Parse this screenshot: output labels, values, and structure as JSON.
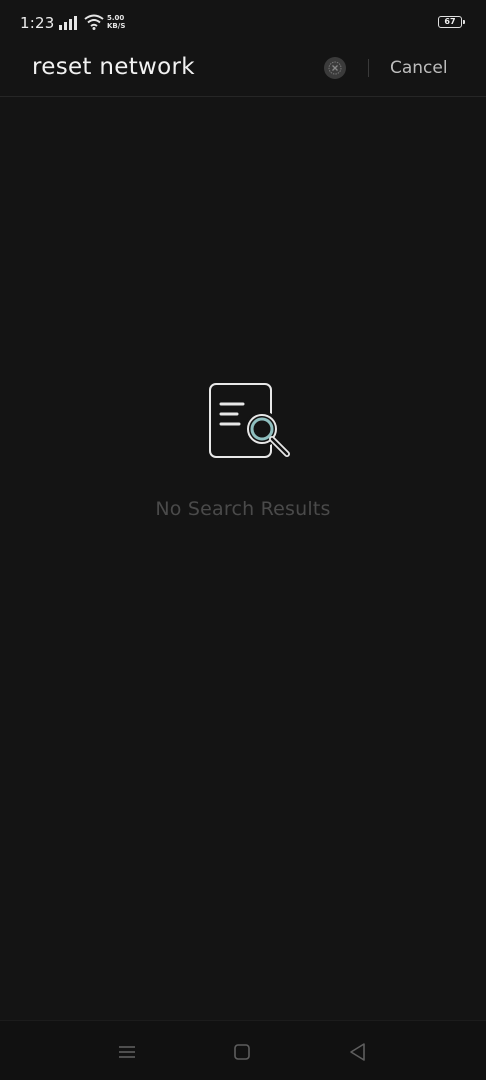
{
  "status_bar": {
    "time": "1:23",
    "net_speed_value": "5.00",
    "net_speed_unit": "KB/S",
    "battery_level": "67",
    "icons": [
      "signal-icon",
      "wifi-icon",
      "battery-icon"
    ]
  },
  "search": {
    "query": "reset network",
    "clear_icon": "clear-icon",
    "cancel_label": "Cancel"
  },
  "empty_state": {
    "icon": "document-search-icon",
    "message": "No Search Results"
  },
  "nav_bar": {
    "icons": [
      "menu-icon",
      "home-icon",
      "back-icon"
    ]
  },
  "colors": {
    "background": "#141414",
    "text_primary": "#f2f2f2",
    "text_muted": "#4a4a4a",
    "accent_icon": "#8fbfbf"
  }
}
